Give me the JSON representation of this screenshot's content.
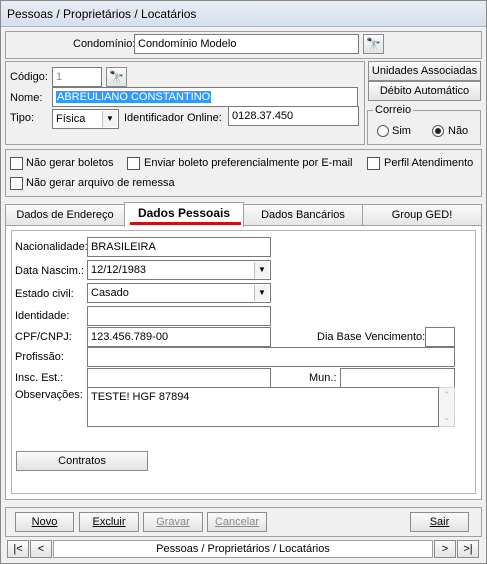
{
  "window": {
    "title": "Pessoas / Proprietários / Locatários"
  },
  "condominio": {
    "label": "Condomínio:",
    "value": "Condomínio Modelo",
    "search_icon": "binoculars-icon"
  },
  "codigo": {
    "label": "Código:",
    "value": "1",
    "search_icon": "binoculars-icon"
  },
  "nome": {
    "label": "Nome:",
    "value": "ABREULIANO CONSTANTINO"
  },
  "tipo": {
    "label": "Tipo:",
    "value": "Física"
  },
  "identificador": {
    "label": "Identificador Online:",
    "value": "0128.37.450"
  },
  "side_buttons": {
    "unidades": "Unidades Associadas",
    "debito": "Débito Automático"
  },
  "correio": {
    "legend": "Correio",
    "sim": "Sim",
    "nao": "Não",
    "selected": "Não"
  },
  "checks": {
    "nao_gerar_boletos": "Não gerar boletos",
    "enviar_email": "Enviar boleto preferencialmente por E-mail",
    "perfil_atendimento": "Perfil Atendimento",
    "nao_gerar_remessa": "Não gerar arquivo de remessa"
  },
  "tabs": [
    {
      "label": "Dados de Endereço"
    },
    {
      "label": "Dados Pessoais"
    },
    {
      "label": "Dados Bancários"
    },
    {
      "label": "Group GED!"
    }
  ],
  "pessoais": {
    "nacionalidade_label": "Nacionalidade:",
    "nacionalidade": "BRASILEIRA",
    "nascimento_label": "Data Nascim.:",
    "nascimento": "12/12/1983",
    "estado_civil_label": "Estado civil:",
    "estado_civil": "Casado",
    "identidade_label": "Identidade:",
    "identidade": "",
    "cpf_label": "CPF/CNPJ:",
    "cpf": "123.456.789-00",
    "dia_base_label": "Dia Base Vencimento:",
    "dia_base": "",
    "profissao_label": "Profissão:",
    "profissao": "",
    "insc_label": "Insc. Est.:",
    "insc": "",
    "mun_label": "Mun.:",
    "mun": "",
    "obs_label": "Observações:",
    "obs": "TESTE! HGF 87894",
    "contratos_button": "Contratos"
  },
  "actions": {
    "novo": "Novo",
    "excluir": "Excluir",
    "gravar": "Gravar",
    "cancelar": "Cancelar",
    "sair": "Sair"
  },
  "nav": {
    "first": "|<",
    "prev": "<",
    "caption": "Pessoas / Proprietários / Locatários",
    "next": ">",
    "last": ">|"
  }
}
